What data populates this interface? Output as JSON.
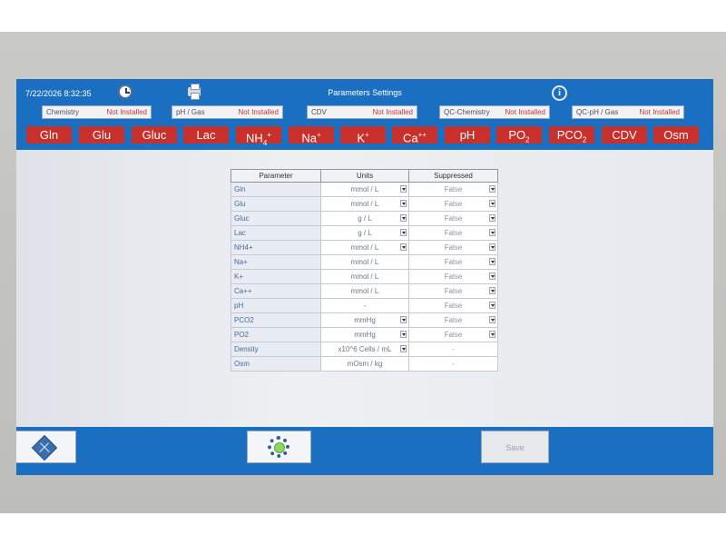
{
  "header": {
    "datetime": "7/22/2026  8:32:35",
    "title": "Parameters Settings",
    "icons": [
      "clock-icon",
      "printer-icon",
      "info-icon"
    ],
    "info_glyph": "i"
  },
  "modules": [
    {
      "name": "Chemistry",
      "status": "Not Installed"
    },
    {
      "name": "pH / Gas",
      "status": "Not Installed"
    },
    {
      "name": "CDV",
      "status": "Not Installed"
    },
    {
      "name": "QC-Chemistry",
      "status": "Not Installed"
    },
    {
      "name": "QC-pH / Gas",
      "status": "Not Installed"
    }
  ],
  "analytes": [
    {
      "base": "Gln",
      "sup": "",
      "sub": ""
    },
    {
      "base": "Glu",
      "sup": "",
      "sub": ""
    },
    {
      "base": "Gluc",
      "sup": "",
      "sub": ""
    },
    {
      "base": "Lac",
      "sup": "",
      "sub": ""
    },
    {
      "base": "NH",
      "sup": "+",
      "sub": "4"
    },
    {
      "base": "Na",
      "sup": "+",
      "sub": ""
    },
    {
      "base": "K",
      "sup": "+",
      "sub": ""
    },
    {
      "base": "Ca",
      "sup": "++",
      "sub": ""
    },
    {
      "base": "pH",
      "sup": "",
      "sub": ""
    },
    {
      "base": "PO",
      "sup": "",
      "sub": "2"
    },
    {
      "base": "PCO",
      "sup": "",
      "sub": "2"
    },
    {
      "base": "CDV",
      "sup": "",
      "sub": ""
    },
    {
      "base": "Osm",
      "sup": "",
      "sub": ""
    }
  ],
  "table": {
    "headers": [
      "Parameter",
      "Units",
      "Suppressed"
    ],
    "rows": [
      {
        "param": "Gln",
        "unit": "mmol / L",
        "unit_dd": true,
        "supp": "False",
        "supp_dd": true
      },
      {
        "param": "Glu",
        "unit": "mmol / L",
        "unit_dd": true,
        "supp": "False",
        "supp_dd": true
      },
      {
        "param": "Gluc",
        "unit": "g / L",
        "unit_dd": true,
        "supp": "False",
        "supp_dd": true
      },
      {
        "param": "Lac",
        "unit": "g / L",
        "unit_dd": true,
        "supp": "False",
        "supp_dd": true
      },
      {
        "param": "NH4+",
        "unit": "mmol / L",
        "unit_dd": true,
        "supp": "False",
        "supp_dd": true
      },
      {
        "param": "Na+",
        "unit": "mmol / L",
        "unit_dd": false,
        "supp": "False",
        "supp_dd": true
      },
      {
        "param": "K+",
        "unit": "mmol / L",
        "unit_dd": false,
        "supp": "False",
        "supp_dd": true
      },
      {
        "param": "Ca++",
        "unit": "mmol / L",
        "unit_dd": false,
        "supp": "False",
        "supp_dd": true
      },
      {
        "param": "pH",
        "unit": "-",
        "unit_dd": false,
        "supp": "False",
        "supp_dd": true
      },
      {
        "param": "PCO2",
        "unit": "mmHg",
        "unit_dd": true,
        "supp": "False",
        "supp_dd": true
      },
      {
        "param": "PO2",
        "unit": "mmHg",
        "unit_dd": true,
        "supp": "False",
        "supp_dd": true
      },
      {
        "param": "Density",
        "unit": "x10^6 Cells / mL",
        "unit_dd": true,
        "supp": "-",
        "supp_dd": false
      },
      {
        "param": "Osm",
        "unit": "mOsm / kg",
        "unit_dd": false,
        "supp": "-",
        "supp_dd": false
      }
    ]
  },
  "footer": {
    "save_label": "Save",
    "icons": [
      "network-grid-icon",
      "gear-icon"
    ]
  },
  "colors": {
    "header_blue": "#1b6fc0",
    "analyte_red": "#c8302c",
    "status_red": "#c43a3a"
  }
}
